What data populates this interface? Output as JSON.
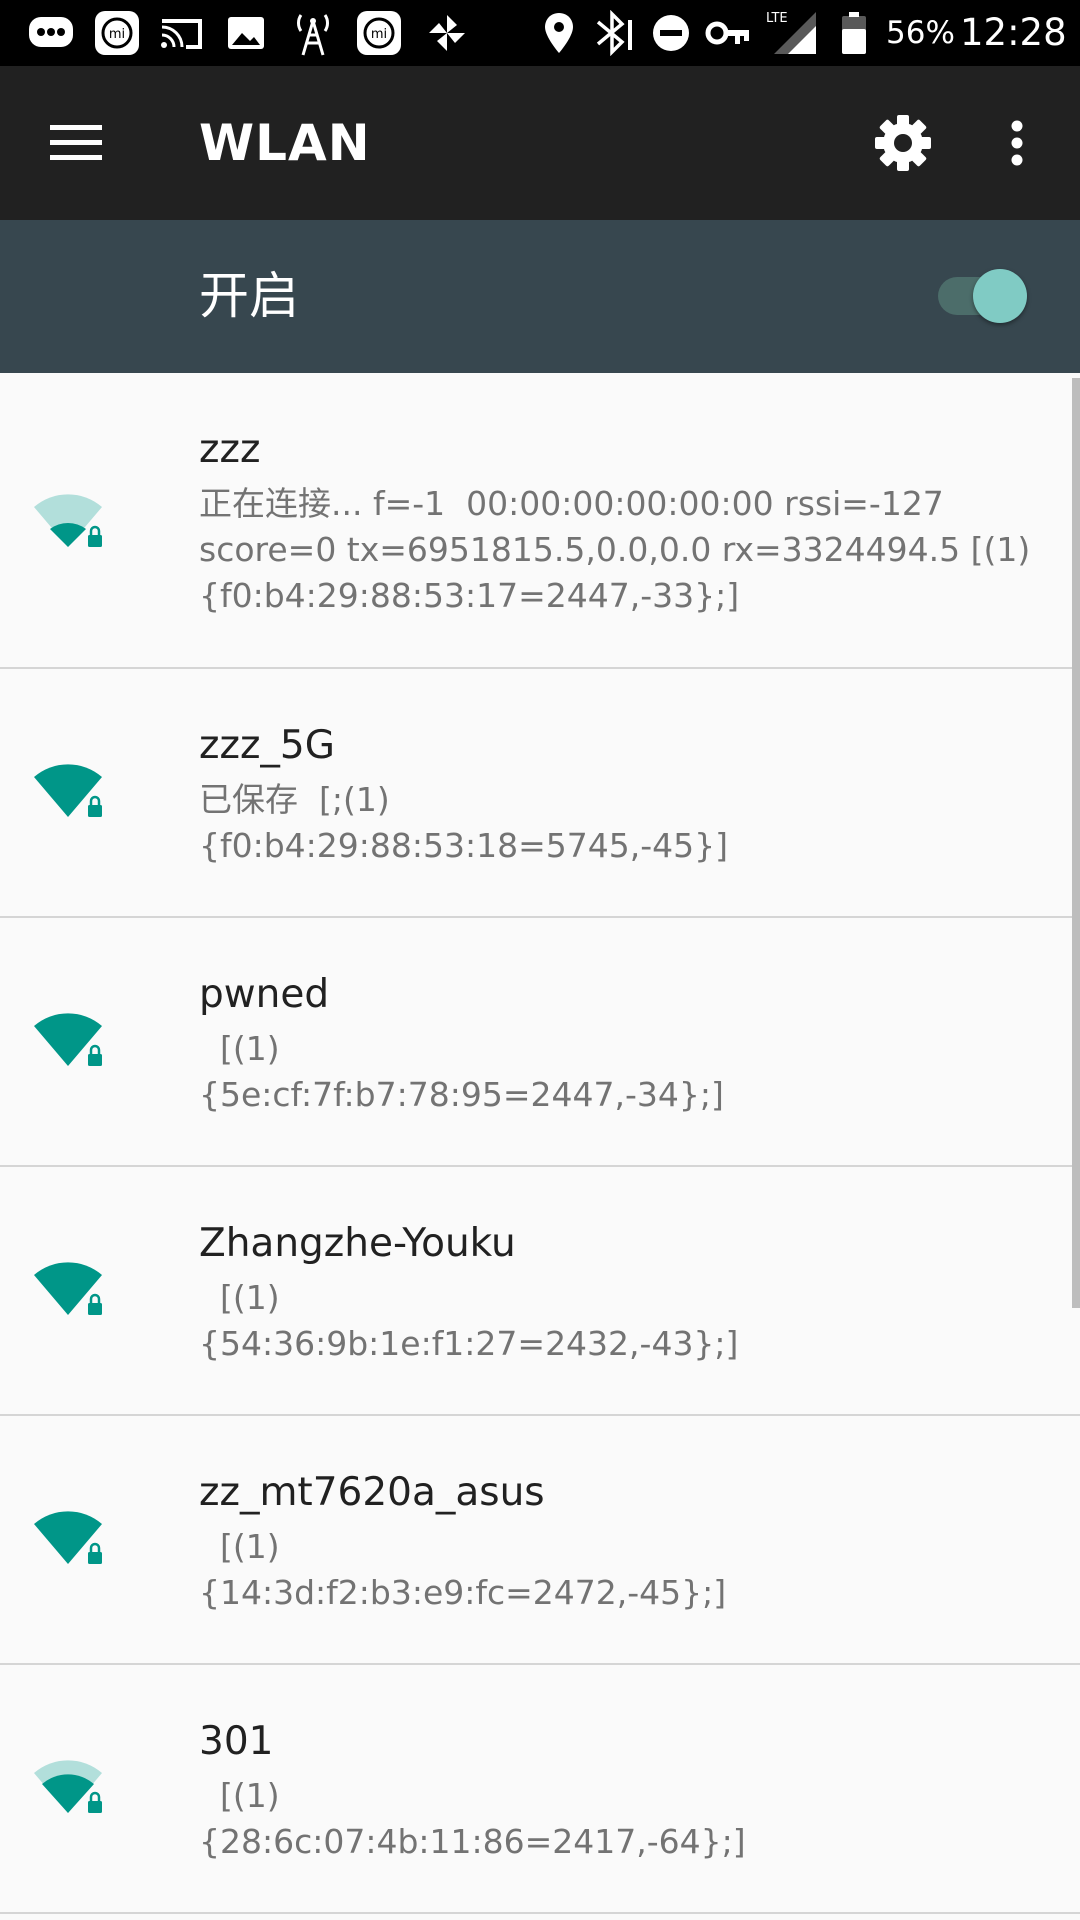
{
  "status_bar": {
    "icons": [
      "messages-icon",
      "mi-app-icon",
      "cast-icon",
      "image-icon",
      "radio-tower-icon",
      "mi-app-icon",
      "pinwheel-icon",
      "location-icon",
      "bluetooth-icon",
      "do-not-disturb-icon",
      "vpn-key-icon",
      "lte-signal-icon",
      "battery-icon"
    ],
    "lte_label": "LTE",
    "battery": "56%",
    "time": "12:28"
  },
  "app_bar": {
    "title": "WLAN",
    "menu_icon": "hamburger-menu-icon",
    "settings_icon": "gear-icon",
    "more_icon": "more-vert-icon"
  },
  "master_switch": {
    "label": "开启",
    "state": "on",
    "accent": "#80cbc4"
  },
  "colors": {
    "wifi_full": "#009688",
    "wifi_dim": "#b2dfdb",
    "header_bg": "#37474f",
    "app_bar_bg": "#212121"
  },
  "networks": [
    {
      "ssid": "zzz",
      "summary": "正在连接... f=-1  00:00:00:00:00:00 rssi=-127\nscore=0 tx=6951815.5,0.0,0.0 rx=3324494.5 [(1)\n{f0:b4:29:88:53:17=2447,-33};]",
      "signal": "weak",
      "secured": true
    },
    {
      "ssid": "zzz_5G",
      "summary": "已保存  [;(1)\n{f0:b4:29:88:53:18=5745,-45}]",
      "signal": "full",
      "secured": true
    },
    {
      "ssid": "pwned",
      "summary": "  [(1)\n{5e:cf:7f:b7:78:95=2447,-34};]",
      "signal": "full",
      "secured": true
    },
    {
      "ssid": "Zhangzhe-Youku",
      "summary": "  [(1)\n{54:36:9b:1e:f1:27=2432,-43};]",
      "signal": "full",
      "secured": true
    },
    {
      "ssid": "zz_mt7620a_asus",
      "summary": "  [(1)\n{14:3d:f2:b3:e9:fc=2472,-45};]",
      "signal": "full",
      "secured": true
    },
    {
      "ssid": "301",
      "summary": "  [(1)\n{28:6c:07:4b:11:86=2417,-64};]",
      "signal": "medium",
      "secured": true
    }
  ]
}
